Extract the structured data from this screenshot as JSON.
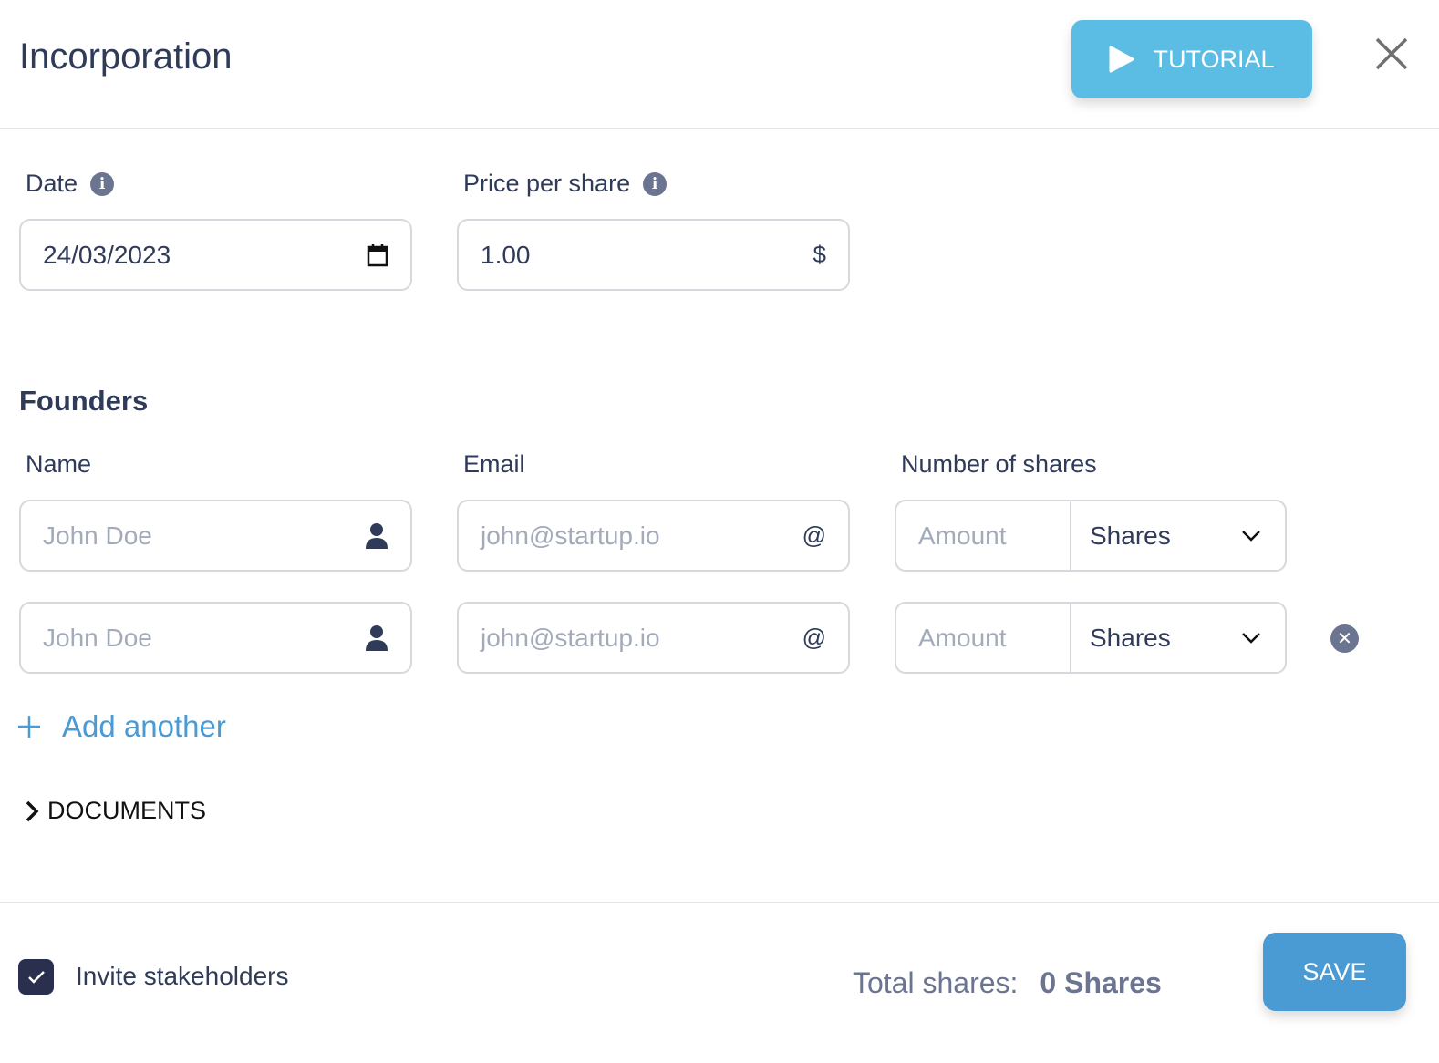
{
  "header": {
    "title": "Incorporation",
    "tutorial_label": "TUTORIAL"
  },
  "fields": {
    "date": {
      "label": "Date",
      "value": "24/03/2023"
    },
    "price": {
      "label": "Price per share",
      "value": "1.00",
      "suffix": "$"
    }
  },
  "founders": {
    "title": "Founders",
    "columns": {
      "name": "Name",
      "email": "Email",
      "shares": "Number of shares"
    },
    "rows": [
      {
        "name_placeholder": "John Doe",
        "email_placeholder": "john@startup.io",
        "email_suffix": "@",
        "amount_placeholder": "Amount",
        "unit": "Shares"
      },
      {
        "name_placeholder": "John Doe",
        "email_placeholder": "john@startup.io",
        "email_suffix": "@",
        "amount_placeholder": "Amount",
        "unit": "Shares"
      }
    ],
    "add_label": "Add another"
  },
  "documents_label": "DOCUMENTS",
  "footer": {
    "invite_label": "Invite stakeholders",
    "invite_checked": true,
    "total_label": "Total shares:",
    "total_value": "0 Shares",
    "save_label": "SAVE"
  },
  "colors": {
    "tutorial": "#5bbde4",
    "save": "#4a9ad4",
    "link": "#4a9ad4",
    "checkbox": "#2b2f4e"
  }
}
